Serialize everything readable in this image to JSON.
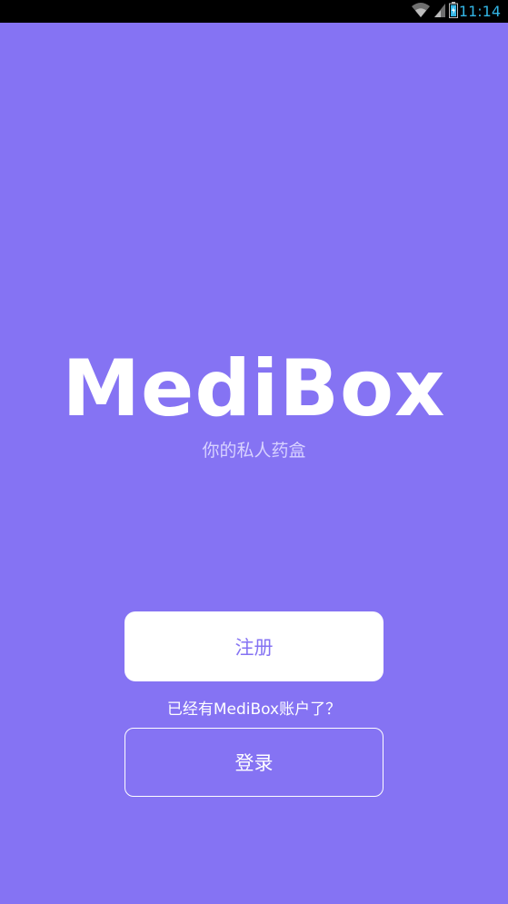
{
  "status_bar": {
    "time": "11:14",
    "icons": [
      "wifi-icon",
      "signal-icon",
      "battery-icon"
    ]
  },
  "app": {
    "logo_text": "MediBox",
    "tagline": "你的私人药盒"
  },
  "actions": {
    "register_label": "注册",
    "account_hint": "已经有MediBox账户了？",
    "login_label": "登录"
  },
  "colors": {
    "background": "#8573f3",
    "primary_text_on_button": "#8573f3",
    "status_accent": "#33b5e5"
  }
}
